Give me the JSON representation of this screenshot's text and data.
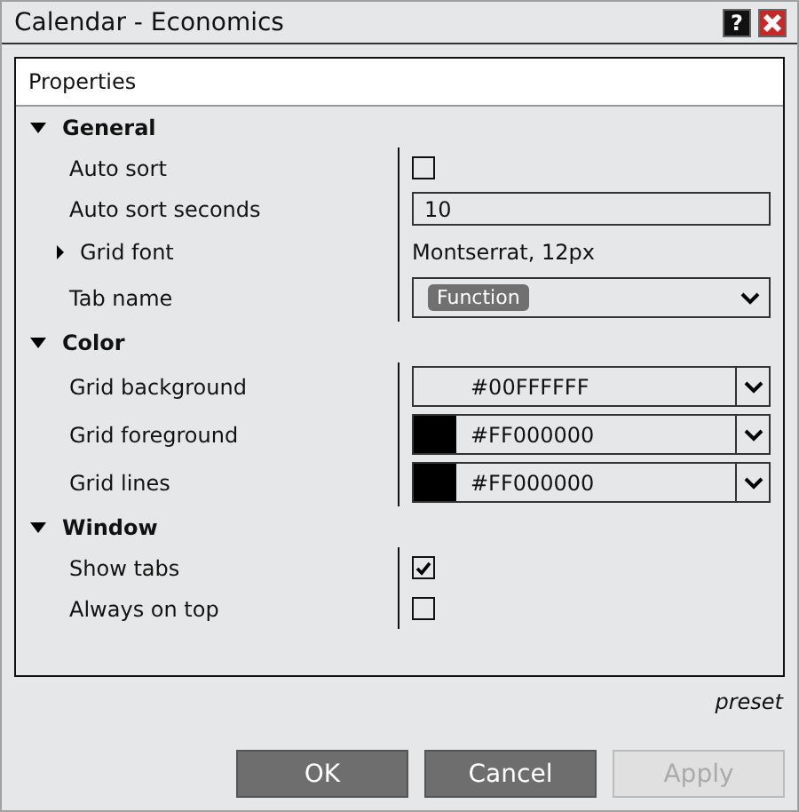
{
  "window": {
    "title": "Calendar - Economics",
    "help_button": "?"
  },
  "properties": {
    "header": "Properties",
    "sections": [
      {
        "title": "General",
        "expanded": true,
        "rows": [
          {
            "kind": "checkbox",
            "label": "Auto sort",
            "checked": false
          },
          {
            "kind": "text",
            "label": "Auto sort seconds",
            "value": "10"
          },
          {
            "kind": "group",
            "label": "Grid font",
            "expanded": false,
            "value": "Montserrat, 12px"
          },
          {
            "kind": "dropdown",
            "label": "Tab name",
            "chip": "Function"
          }
        ]
      },
      {
        "title": "Color",
        "expanded": true,
        "rows": [
          {
            "kind": "color",
            "label": "Grid background",
            "value": "#00FFFFFF"
          },
          {
            "kind": "color",
            "label": "Grid foreground",
            "value": "#FF000000",
            "color": "#000000"
          },
          {
            "kind": "color",
            "label": "Grid lines",
            "value": "#FF000000",
            "color": "#000000"
          }
        ]
      },
      {
        "title": "Window",
        "expanded": true,
        "rows": [
          {
            "kind": "checkbox",
            "label": "Show tabs",
            "checked": true
          },
          {
            "kind": "checkbox",
            "label": "Always on top",
            "checked": false
          }
        ]
      }
    ]
  },
  "preset": "preset",
  "buttons": [
    {
      "label": "OK",
      "disabled": false
    },
    {
      "label": "Cancel",
      "disabled": false
    },
    {
      "label": "Apply",
      "disabled": true
    }
  ]
}
